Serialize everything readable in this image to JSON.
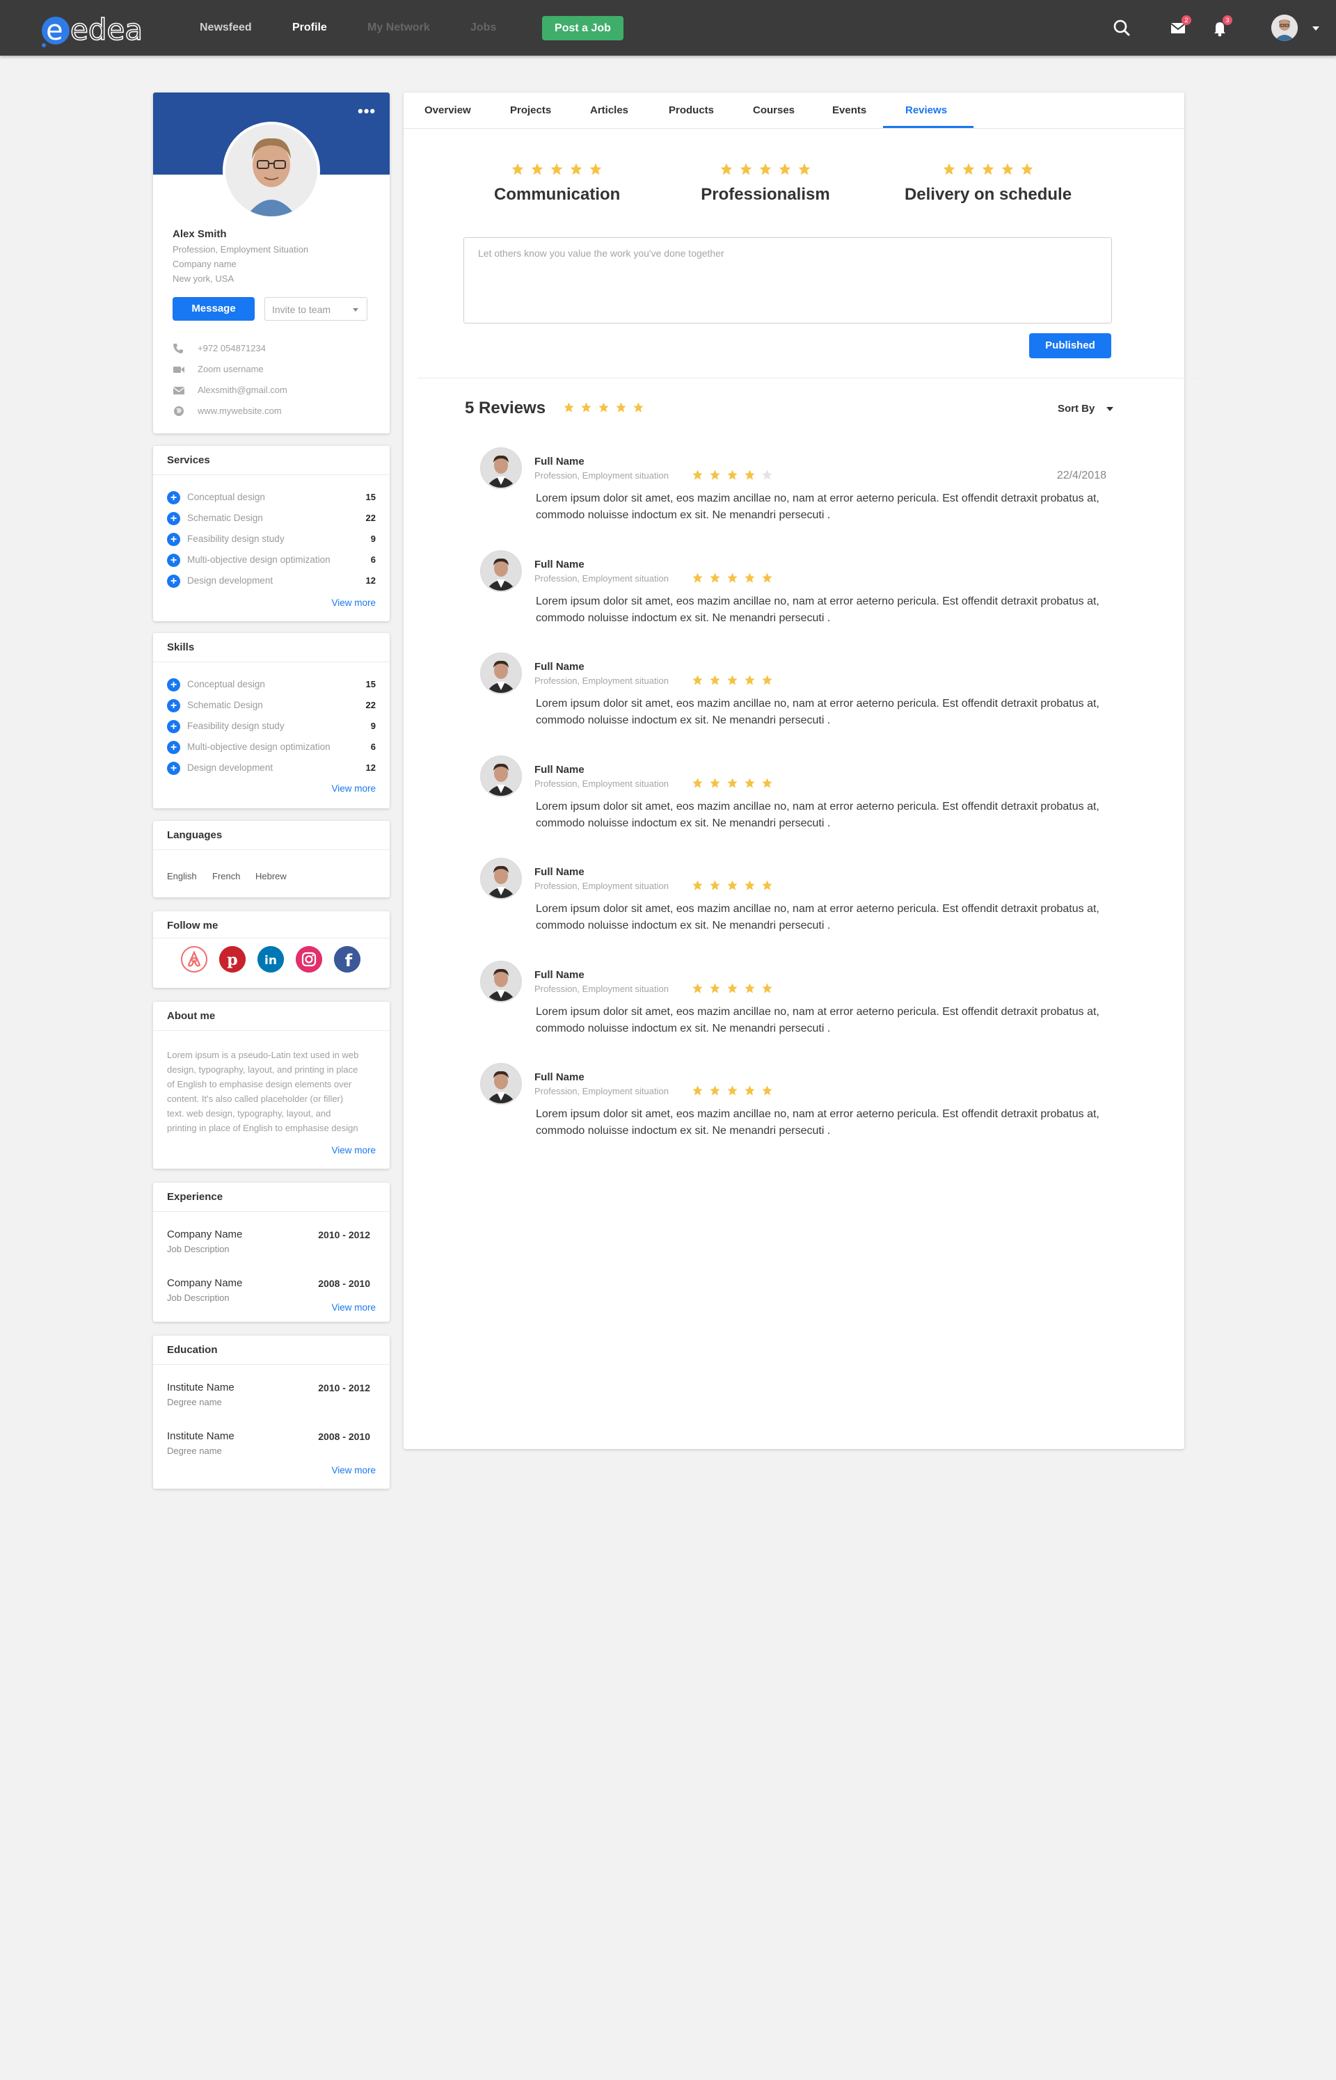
{
  "colors": {
    "accent": "#1877f2",
    "topbar": "#3b3b3b",
    "banner": "#264f9c",
    "post_job": "#3fae6a",
    "star": "#f5c244",
    "star_empty": "#e3e3e3",
    "badge": "#e8546b"
  },
  "header": {
    "logo": "edea",
    "nav": [
      "Newsfeed",
      "Profile",
      "My Network",
      "Jobs"
    ],
    "post_job": "Post a Job",
    "mail_badge": "2",
    "bell_badge": "3"
  },
  "profile": {
    "name": "Alex Smith",
    "profession": "Profession, Employment Situation",
    "company": "Company name",
    "location": "New york, USA",
    "message_button": "Message",
    "invite_select": "Invite to team",
    "phone": "+972 054871234",
    "zoom": "Zoom username",
    "email": "Alexsmith@gmail.com",
    "website": "www.mywebsite.com",
    "more": "•••"
  },
  "services": {
    "title": "Services",
    "items": [
      {
        "label": "Conceptual design",
        "count": "15"
      },
      {
        "label": "Schematic Design",
        "count": "22"
      },
      {
        "label": "Feasibility design study",
        "count": "9"
      },
      {
        "label": "Multi-objective design optimization",
        "count": "6"
      },
      {
        "label": "Design development",
        "count": "12"
      }
    ],
    "view_more": "View more"
  },
  "skills": {
    "title": "Skills",
    "items": [
      {
        "label": "Conceptual design",
        "count": "15"
      },
      {
        "label": "Schematic Design",
        "count": "22"
      },
      {
        "label": "Feasibility design study",
        "count": "9"
      },
      {
        "label": "Multi-objective design optimization",
        "count": "6"
      },
      {
        "label": "Design development",
        "count": "12"
      }
    ],
    "view_more": "View more"
  },
  "languages": {
    "title": "Languages",
    "items": [
      "English",
      "French",
      "Hebrew"
    ]
  },
  "follow": {
    "title": "Follow me",
    "networks": [
      "airbnb-icon",
      "pinterest-icon",
      "linkedin-icon",
      "instagram-icon",
      "facebook-icon"
    ]
  },
  "about": {
    "title": "About me",
    "lines": [
      "Lorem ipsum is a pseudo-Latin text used in web",
      "design, typography, layout, and printing in place",
      "of English to emphasise design elements over",
      "content. It's also called placeholder (or filler)",
      "text. web design, typography, layout, and",
      "printing in place of English to emphasise design"
    ],
    "view_more": "View more"
  },
  "experience": {
    "title": "Experience",
    "items": [
      {
        "name": "Company Name",
        "desc": "Job Description",
        "years": "2010 - 2012"
      },
      {
        "name": "Company Name",
        "desc": "Job Description",
        "years": "2008 - 2010"
      }
    ],
    "view_more": "View more"
  },
  "education": {
    "title": "Education",
    "items": [
      {
        "name": "Institute Name",
        "desc": "Degree name",
        "years": "2010 - 2012"
      },
      {
        "name": "Institute Name",
        "desc": "Degree name",
        "years": "2008 - 2010"
      }
    ],
    "view_more": "View more"
  },
  "tabs": [
    "Overview",
    "Projects",
    "Articles",
    "Products",
    "Courses",
    "Events",
    "Reviews"
  ],
  "active_tab": "Reviews",
  "rating_categories": [
    {
      "label": "Communication",
      "stars": 5
    },
    {
      "label": "Professionalism",
      "stars": 5
    },
    {
      "label": "Delivery on schedule",
      "stars": 5
    }
  ],
  "review_form": {
    "placeholder": "Let others know you value the work you've done together",
    "submit": "Published"
  },
  "reviews_summary": {
    "title": "5 Reviews",
    "stars": 5,
    "sort_by": "Sort By"
  },
  "reviews": [
    {
      "name": "Full Name",
      "profession": "Profession, Employment situation",
      "stars": 4,
      "date": "22/4/2018",
      "line1": "Lorem ipsum dolor sit amet, eos mazim ancillae no, nam at error aeterno pericula. Est offendit detraxit probatus at,",
      "line2": "commodo noluisse indoctum ex sit. Ne menandri persecuti ."
    },
    {
      "name": "Full Name",
      "profession": "Profession, Employment situation",
      "stars": 5,
      "date": "",
      "line1": "Lorem ipsum dolor sit amet, eos mazim ancillae no, nam at error aeterno pericula. Est offendit detraxit probatus at,",
      "line2": "commodo noluisse indoctum ex sit. Ne menandri persecuti ."
    },
    {
      "name": "Full Name",
      "profession": "Profession, Employment situation",
      "stars": 5,
      "date": "",
      "line1": "Lorem ipsum dolor sit amet, eos mazim ancillae no, nam at error aeterno pericula. Est offendit detraxit probatus at,",
      "line2": "commodo noluisse indoctum ex sit. Ne menandri persecuti ."
    },
    {
      "name": "Full Name",
      "profession": "Profession, Employment situation",
      "stars": 5,
      "date": "",
      "line1": "Lorem ipsum dolor sit amet, eos mazim ancillae no, nam at error aeterno pericula. Est offendit detraxit probatus at,",
      "line2": "commodo noluisse indoctum ex sit. Ne menandri persecuti ."
    },
    {
      "name": "Full Name",
      "profession": "Profession, Employment situation",
      "stars": 5,
      "date": "",
      "line1": "Lorem ipsum dolor sit amet, eos mazim ancillae no, nam at error aeterno pericula. Est offendit detraxit probatus at,",
      "line2": "commodo noluisse indoctum ex sit. Ne menandri persecuti ."
    },
    {
      "name": "Full Name",
      "profession": "Profession, Employment situation",
      "stars": 5,
      "date": "",
      "line1": "Lorem ipsum dolor sit amet, eos mazim ancillae no, nam at error aeterno pericula. Est offendit detraxit probatus at,",
      "line2": "commodo noluisse indoctum ex sit. Ne menandri persecuti ."
    },
    {
      "name": "Full Name",
      "profession": "Profession, Employment situation",
      "stars": 5,
      "date": "",
      "line1": "Lorem ipsum dolor sit amet, eos mazim ancillae no, nam at error aeterno pericula. Est offendit detraxit probatus at,",
      "line2": "commodo noluisse indoctum ex sit. Ne menandri persecuti ."
    }
  ]
}
